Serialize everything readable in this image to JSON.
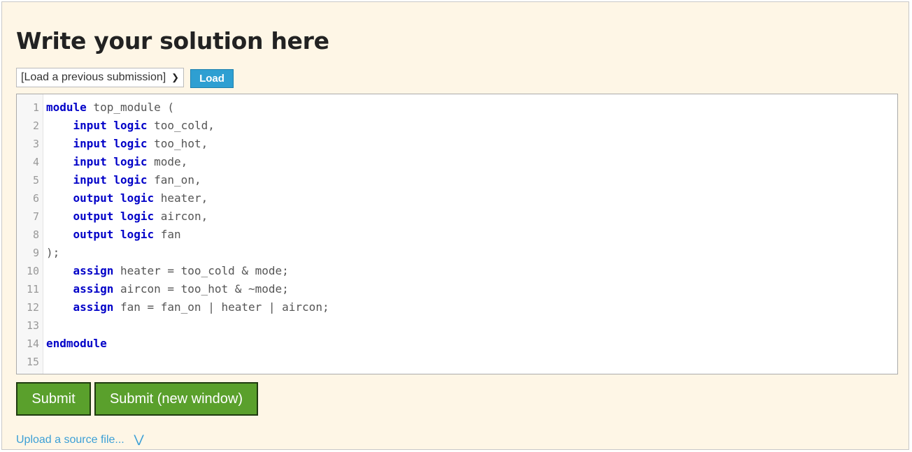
{
  "page": {
    "title": "Write your solution here"
  },
  "toolbar": {
    "select_value": "[Load a previous submission]",
    "load_label": "Load"
  },
  "editor": {
    "lines": [
      [
        {
          "t": "module",
          "k": true
        },
        {
          "t": " top_module ("
        }
      ],
      [
        {
          "t": "    "
        },
        {
          "t": "input",
          "k": true
        },
        {
          "t": " "
        },
        {
          "t": "logic",
          "k": true
        },
        {
          "t": " too_cold,"
        }
      ],
      [
        {
          "t": "    "
        },
        {
          "t": "input",
          "k": true
        },
        {
          "t": " "
        },
        {
          "t": "logic",
          "k": true
        },
        {
          "t": " too_hot,"
        }
      ],
      [
        {
          "t": "    "
        },
        {
          "t": "input",
          "k": true
        },
        {
          "t": " "
        },
        {
          "t": "logic",
          "k": true
        },
        {
          "t": " mode,"
        }
      ],
      [
        {
          "t": "    "
        },
        {
          "t": "input",
          "k": true
        },
        {
          "t": " "
        },
        {
          "t": "logic",
          "k": true
        },
        {
          "t": " fan_on,"
        }
      ],
      [
        {
          "t": "    "
        },
        {
          "t": "output",
          "k": true
        },
        {
          "t": " "
        },
        {
          "t": "logic",
          "k": true
        },
        {
          "t": " heater,"
        }
      ],
      [
        {
          "t": "    "
        },
        {
          "t": "output",
          "k": true
        },
        {
          "t": " "
        },
        {
          "t": "logic",
          "k": true
        },
        {
          "t": " aircon,"
        }
      ],
      [
        {
          "t": "    "
        },
        {
          "t": "output",
          "k": true
        },
        {
          "t": " "
        },
        {
          "t": "logic",
          "k": true
        },
        {
          "t": " fan"
        }
      ],
      [
        {
          "t": ");"
        }
      ],
      [
        {
          "t": "    "
        },
        {
          "t": "assign",
          "k": true
        },
        {
          "t": " heater = too_cold & mode;"
        }
      ],
      [
        {
          "t": "    "
        },
        {
          "t": "assign",
          "k": true
        },
        {
          "t": " aircon = too_hot & ~mode;"
        }
      ],
      [
        {
          "t": "    "
        },
        {
          "t": "assign",
          "k": true
        },
        {
          "t": " fan = fan_on | heater | aircon;"
        }
      ],
      [],
      [
        {
          "t": "endmodule",
          "k": true
        }
      ],
      []
    ]
  },
  "actions": {
    "submit_label": "Submit",
    "submit_new_window_label": "Submit (new window)",
    "upload_label": "Upload a source file...",
    "upload_icon": "double-chevron-down-icon"
  },
  "colors": {
    "background": "#fef6e6",
    "keyword": "#0000c8",
    "load_button": "#2e9fd2",
    "submit_button": "#5aa02c",
    "link": "#3b9fd6"
  }
}
